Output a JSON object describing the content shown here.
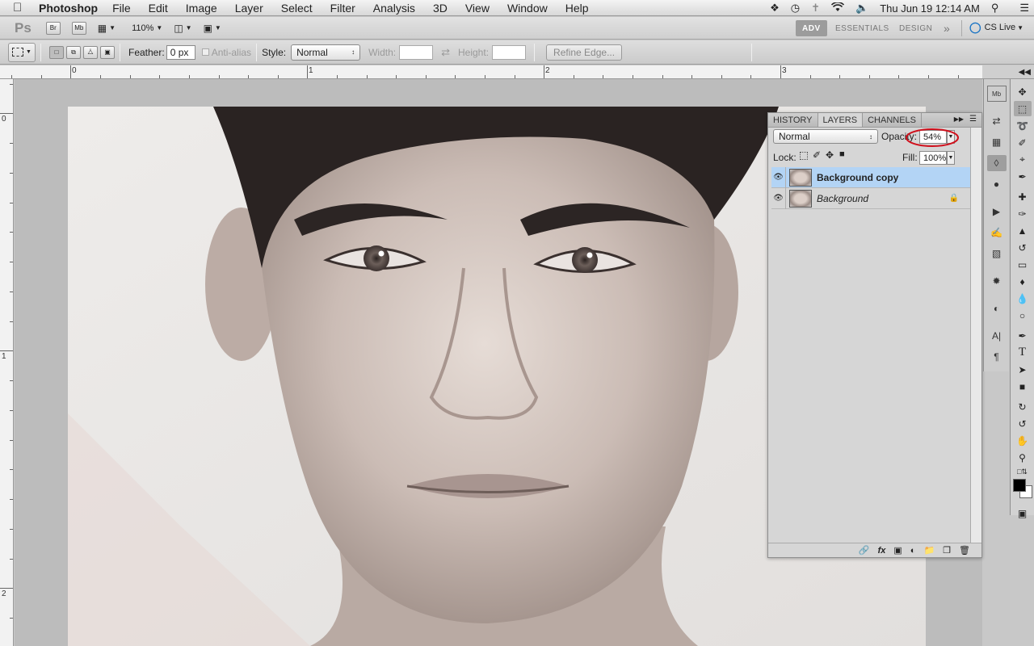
{
  "menubar": {
    "app_name": "Photoshop",
    "items": [
      "File",
      "Edit",
      "Image",
      "Layer",
      "Select",
      "Filter",
      "Analysis",
      "3D",
      "View",
      "Window",
      "Help"
    ],
    "datetime": "Thu Jun 19  12:14 AM"
  },
  "appbar": {
    "logo": "Ps",
    "bridge_label": "Br",
    "minibridge_label": "Mb",
    "zoom": "110%",
    "workspaces": [
      "ADV",
      "ESSENTIALS",
      "DESIGN"
    ],
    "more": "»",
    "cs_live": "CS Live"
  },
  "options": {
    "feather_label": "Feather:",
    "feather_value": "0 px",
    "antialias_label": "Anti-alias",
    "style_label": "Style:",
    "style_value": "Normal",
    "width_label": "Width:",
    "height_label": "Height:",
    "refine_edge": "Refine Edge..."
  },
  "rulers": {
    "top_labels": [
      "0",
      "1",
      "2",
      "3"
    ],
    "left_labels": [
      "0",
      "1",
      "2"
    ]
  },
  "panel": {
    "tabs": [
      "HISTORY",
      "LAYERS",
      "CHANNELS"
    ],
    "blend_mode": "Normal",
    "opacity_label": "Opacity:",
    "opacity_value": "54%",
    "lock_label": "Lock:",
    "fill_label": "Fill:",
    "fill_value": "100%",
    "layers": [
      {
        "name": "Background copy",
        "selected": true,
        "locked": false
      },
      {
        "name": "Background",
        "selected": false,
        "locked": true
      }
    ]
  },
  "colors": {
    "selection": "#b3d4f5",
    "annotation_circle": "#d0101c"
  }
}
